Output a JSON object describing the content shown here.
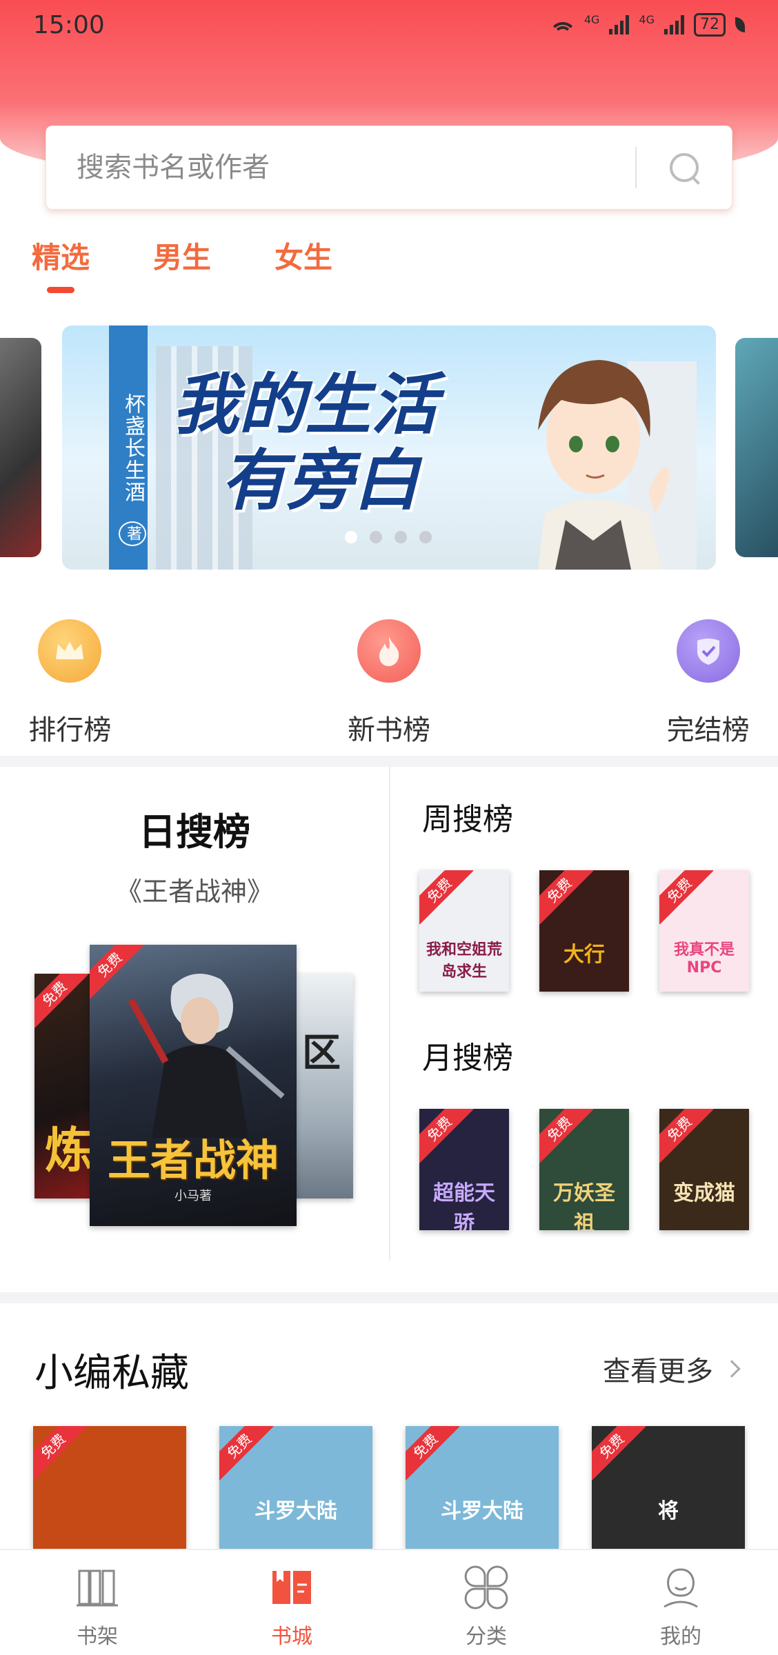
{
  "status": {
    "time": "15:00",
    "net1": "4G",
    "net2": "4G",
    "battery": "72"
  },
  "search": {
    "placeholder": "搜索书名或作者"
  },
  "tabs": [
    {
      "label": "精选",
      "active": true
    },
    {
      "label": "男生",
      "active": false
    },
    {
      "label": "女生",
      "active": false
    }
  ],
  "banner": {
    "author": "杯盏长生酒",
    "author_mark": "著",
    "title_line1": "我的生活",
    "title_line2": "有旁白",
    "dots": 4,
    "active_dot": 0
  },
  "ranks": [
    {
      "label": "排行榜",
      "icon": "crown-icon",
      "color": "#f8b84e"
    },
    {
      "label": "新书榜",
      "icon": "flame-icon",
      "color": "#f7645e"
    },
    {
      "label": "完结榜",
      "icon": "shield-check-icon",
      "color": "#8f74e6"
    }
  ],
  "boards": {
    "free_tag": "免费",
    "day": {
      "title": "日搜榜",
      "book": "《王者战神》",
      "main_cover_title": "王者战神",
      "main_cover_author": "小马著",
      "left_cover_text": "炼",
      "right_cover_text": "区"
    },
    "week": {
      "title": "周搜榜",
      "covers": [
        {
          "text": "我和空姐荒岛求生",
          "bg": "#eef0f3",
          "fg": "#8a1a4a"
        },
        {
          "text": "大行",
          "bg": "#3a1d18",
          "fg": "#f4b41a"
        },
        {
          "text": "我真不是NPC",
          "bg": "#fbe6ee",
          "fg": "#e8457e"
        }
      ]
    },
    "month": {
      "title": "月搜榜",
      "covers": [
        {
          "text": "超能天骄",
          "bg": "#25233f",
          "fg": "#c8a9ff"
        },
        {
          "text": "万妖圣祖",
          "bg": "#2f4b3a",
          "fg": "#f1d27a"
        },
        {
          "text": "变成猫",
          "bg": "#3b2a1a",
          "fg": "#f7e3b5"
        }
      ]
    }
  },
  "picks": {
    "title": "小编私藏",
    "more": "查看更多",
    "covers": [
      {
        "text": "",
        "bg": "#c64a16"
      },
      {
        "text": "斗罗大陆",
        "bg": "#7db8d8"
      },
      {
        "text": "斗罗大陆",
        "bg": "#7db8d8"
      },
      {
        "text": "将",
        "bg": "#2c2c2c"
      }
    ]
  },
  "nav": [
    {
      "label": "书架",
      "icon": "bookshelf-icon",
      "active": false
    },
    {
      "label": "书城",
      "icon": "bookstore-icon",
      "active": true
    },
    {
      "label": "分类",
      "icon": "category-icon",
      "active": false
    },
    {
      "label": "我的",
      "icon": "profile-icon",
      "active": false
    }
  ]
}
